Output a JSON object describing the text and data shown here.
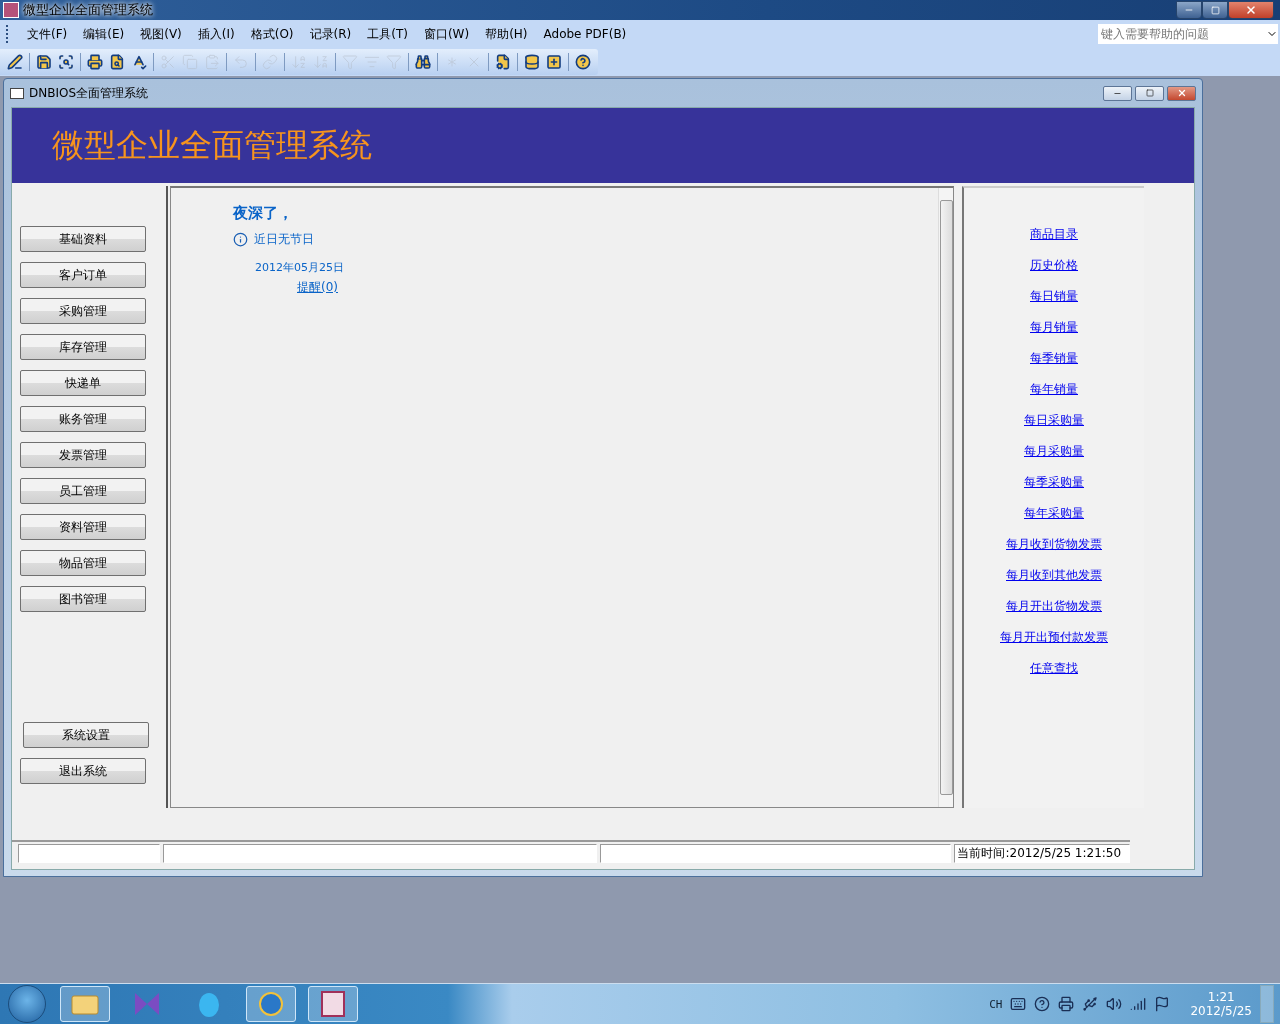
{
  "app": {
    "title": "微型企业全面管理系统"
  },
  "menu": [
    "文件(F)",
    "编辑(E)",
    "视图(V)",
    "插入(I)",
    "格式(O)",
    "记录(R)",
    "工具(T)",
    "窗口(W)",
    "帮助(H)",
    "Adobe PDF(B)"
  ],
  "help_search": {
    "placeholder": "键入需要帮助的问题"
  },
  "toolbar": [
    {
      "kind": "design",
      "disabled": false
    },
    {
      "kind": "separator"
    },
    {
      "kind": "save",
      "disabled": false
    },
    {
      "kind": "search",
      "disabled": false
    },
    {
      "kind": "separator"
    },
    {
      "kind": "print",
      "disabled": false
    },
    {
      "kind": "preview",
      "disabled": false
    },
    {
      "kind": "spell",
      "disabled": false
    },
    {
      "kind": "separator"
    },
    {
      "kind": "cut",
      "disabled": true
    },
    {
      "kind": "copy",
      "disabled": true
    },
    {
      "kind": "paste",
      "disabled": true
    },
    {
      "kind": "separator"
    },
    {
      "kind": "undo",
      "disabled": true
    },
    {
      "kind": "separator"
    },
    {
      "kind": "link",
      "disabled": true
    },
    {
      "kind": "separator"
    },
    {
      "kind": "sort_asc",
      "disabled": true
    },
    {
      "kind": "sort_desc",
      "disabled": true
    },
    {
      "kind": "separator"
    },
    {
      "kind": "filter_sel",
      "disabled": true
    },
    {
      "kind": "filter_form",
      "disabled": true
    },
    {
      "kind": "filter",
      "disabled": true
    },
    {
      "kind": "separator"
    },
    {
      "kind": "find",
      "disabled": false
    },
    {
      "kind": "separator"
    },
    {
      "kind": "new_record",
      "disabled": true
    },
    {
      "kind": "delete_record",
      "disabled": true
    },
    {
      "kind": "separator"
    },
    {
      "kind": "properties",
      "disabled": false
    },
    {
      "kind": "separator"
    },
    {
      "kind": "database",
      "disabled": false
    },
    {
      "kind": "new_object",
      "disabled": false
    },
    {
      "kind": "separator"
    },
    {
      "kind": "help",
      "disabled": false
    }
  ],
  "child_window": {
    "title": "DNBIOS全面管理系统"
  },
  "banner": {
    "title": "微型企业全面管理系统"
  },
  "nav_buttons": [
    "基础资料",
    "客户订单",
    "采购管理",
    "库存管理",
    "快递单",
    "账务管理",
    "发票管理",
    "员工管理",
    "资料管理",
    "物品管理",
    "图书管理"
  ],
  "system_buttons": [
    "系统设置",
    "退出系统"
  ],
  "center": {
    "greeting": "夜深了，",
    "holiday_notice": "近日无节日",
    "date": "2012年05月25日",
    "reminder_link": "提醒(0)"
  },
  "report_links": [
    "商品目录",
    "历史价格",
    "每日销量",
    "每月销量",
    "每季销量",
    "每年销量",
    "每日采购量",
    "每月采购量",
    "每季采购量",
    "每年采购量",
    "每月收到货物发票",
    "每月收到其他发票",
    "每月开出货物发票",
    "每月开出预付款发票",
    "任意查找"
  ],
  "status_bar": {
    "clock": "当前时间:2012/5/25 1:21:50"
  },
  "taskbar": {
    "language": "CH",
    "time": "1:21",
    "date": "2012/5/25"
  }
}
